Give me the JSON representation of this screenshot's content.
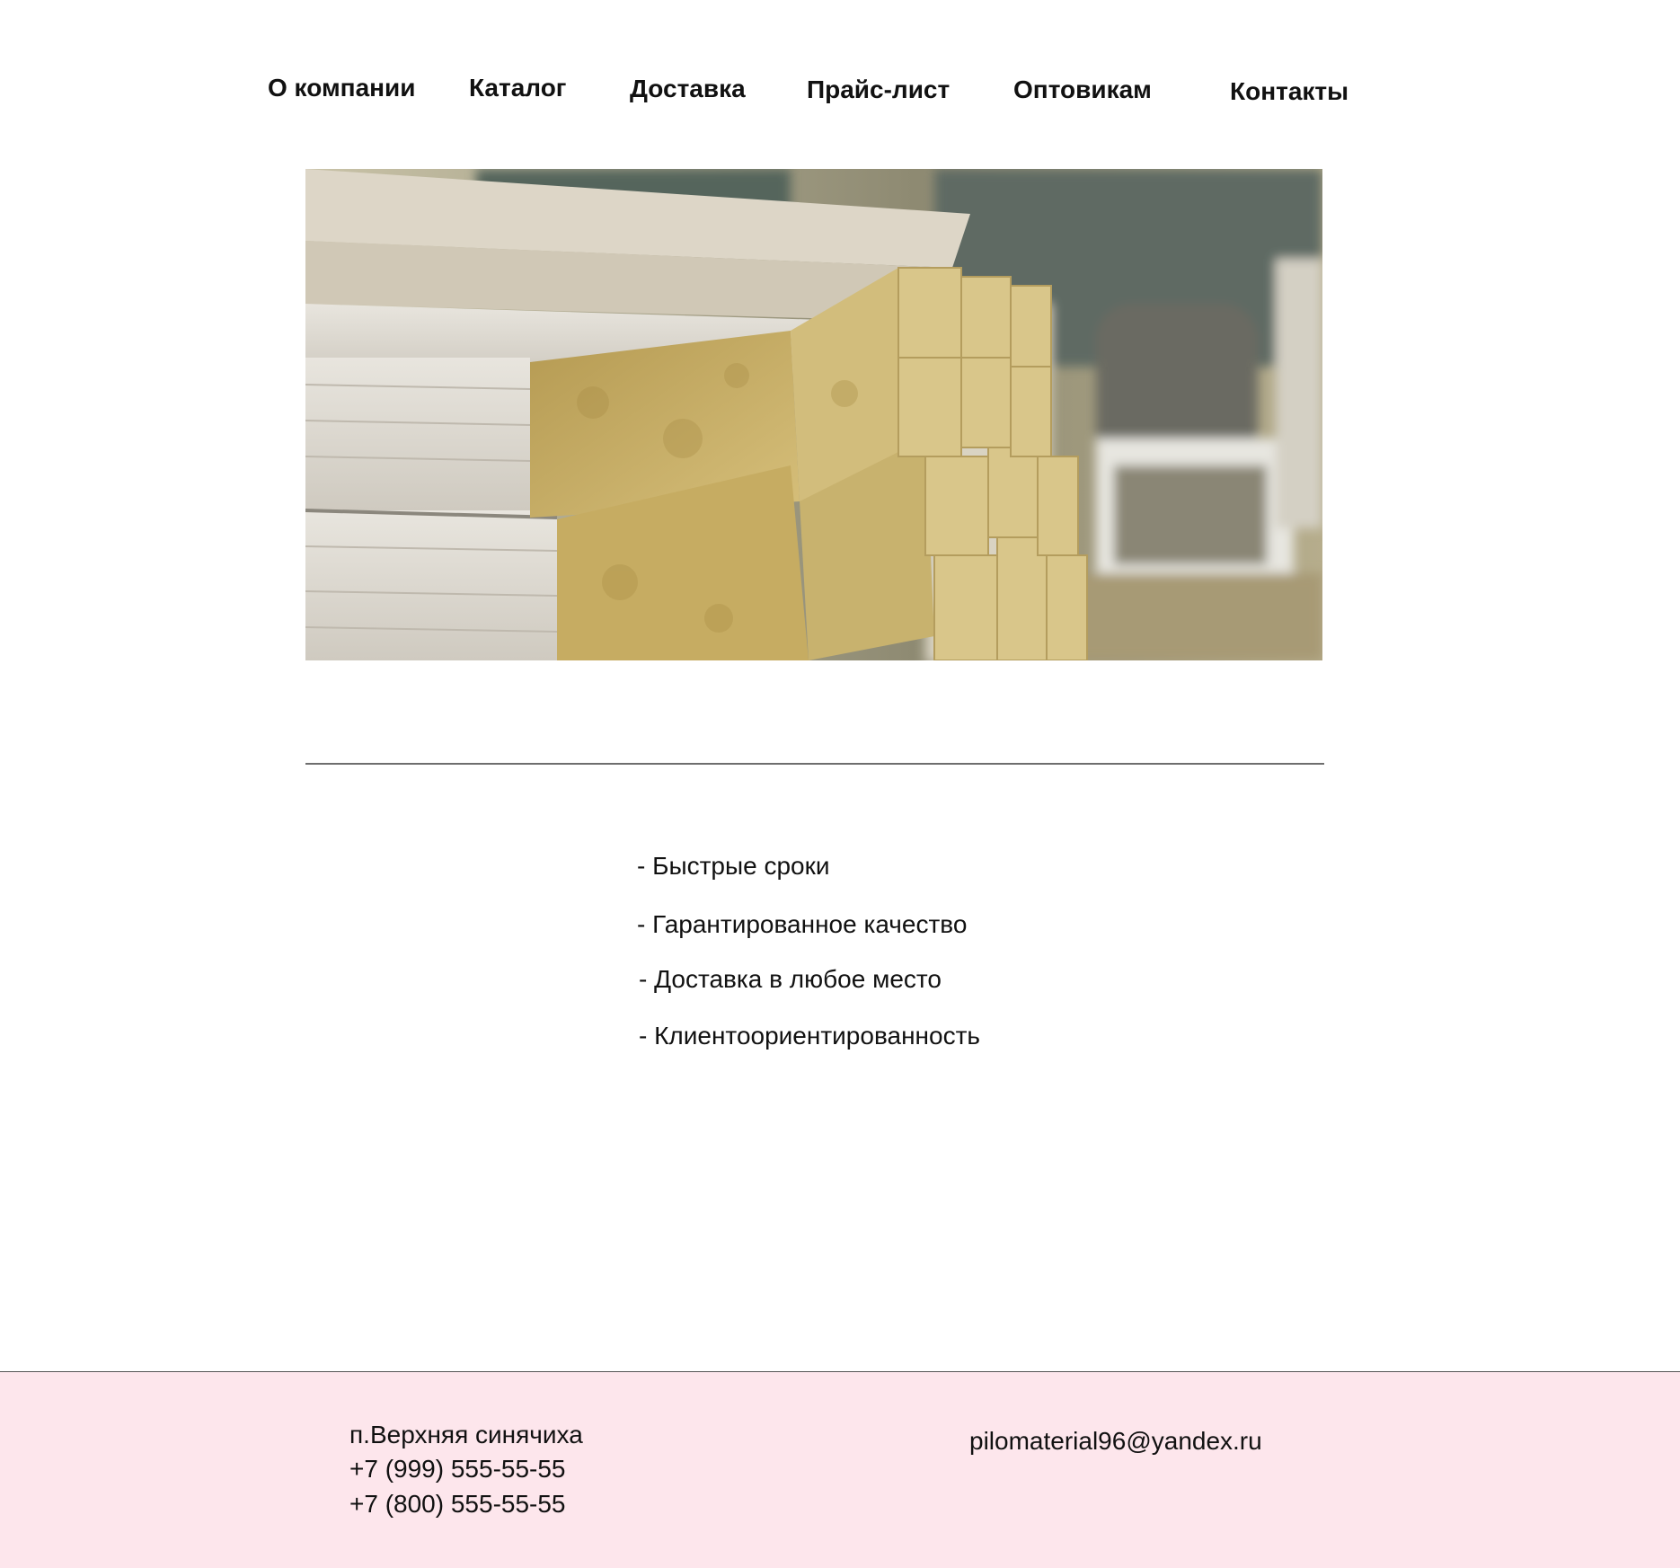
{
  "nav": {
    "items": [
      {
        "label": "О компании"
      },
      {
        "label": "Каталог"
      },
      {
        "label": "Доставка"
      },
      {
        "label": "Прайс-лист"
      },
      {
        "label": "Оптовикам"
      },
      {
        "label": "Контакты"
      }
    ]
  },
  "features": [
    "- Быстрые сроки",
    "- Гарантированное качество",
    "- Доставка в любое место",
    "- Клиентоориентированность"
  ],
  "footer": {
    "address": "п.Верхняя синячиха",
    "phone_1": "+7 (999) 555-55-55",
    "phone_2": "+7 (800) 555-55-55",
    "email": "pilomaterial96@yandex.ru",
    "background_color": "#fde6ec"
  }
}
